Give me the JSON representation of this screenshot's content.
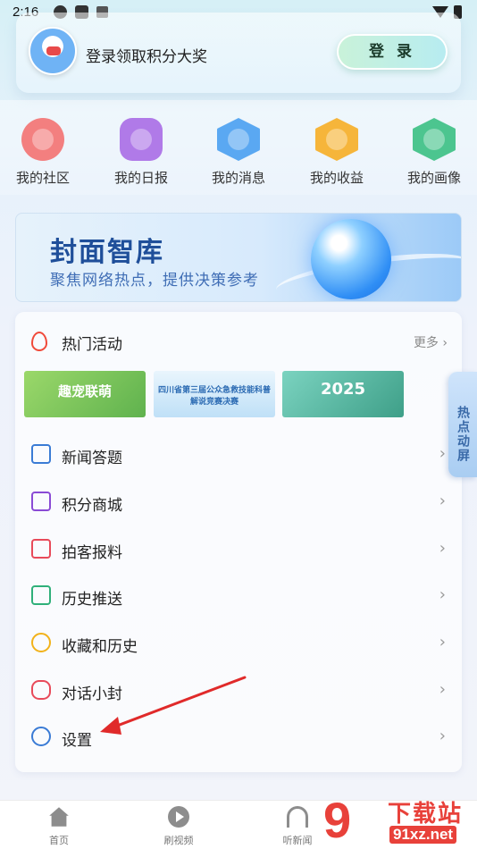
{
  "status_bar": {
    "time": "2:16"
  },
  "login": {
    "prompt": "登录领取积分大奖",
    "button_label": "登 录"
  },
  "quick_items": [
    {
      "label": "我的社区",
      "icon": "planet-icon",
      "color": "#f37f7f"
    },
    {
      "label": "我的日报",
      "icon": "calendar-icon",
      "color": "#b07ae8"
    },
    {
      "label": "我的消息",
      "icon": "message-icon",
      "color": "#5aa8f2"
    },
    {
      "label": "我的收益",
      "icon": "wallet-icon",
      "color": "#f6b53a"
    },
    {
      "label": "我的画像",
      "icon": "profile-chart-icon",
      "color": "#4cc58f"
    }
  ],
  "banner": {
    "title": "封面智库",
    "subtitle": "聚焦网络热点，提供决策参考"
  },
  "hot": {
    "label": "热门活动",
    "more": "更多 ›"
  },
  "thumbnails": [
    {
      "text": "趣宠联萌",
      "bg": "#7cc36a"
    },
    {
      "text": "四川省第三届公众急救技能科普解说竞赛决赛",
      "bg": "#bfe0f7"
    },
    {
      "text": "2025",
      "bg": "#5bb3a0"
    }
  ],
  "menu": [
    {
      "label": "新闻答题",
      "icon": "quiz-icon",
      "color": "#3a7bd5"
    },
    {
      "label": "积分商城",
      "icon": "shopping-bag-icon",
      "color": "#8a4ad5"
    },
    {
      "label": "拍客报料",
      "icon": "camera-icon",
      "color": "#e84a5a"
    },
    {
      "label": "历史推送",
      "icon": "history-calendar-icon",
      "color": "#2fb07a"
    },
    {
      "label": "收藏和历史",
      "icon": "star-icon",
      "color": "#f2b21a"
    },
    {
      "label": "对话小封",
      "icon": "chat-bot-icon",
      "color": "#e84a5a"
    },
    {
      "label": "设置",
      "icon": "settings-hex-icon",
      "color": "#3a7bd5"
    }
  ],
  "side_tab": {
    "label": "热点动屏"
  },
  "bottom_nav": [
    {
      "label": "首页",
      "icon": "home-icon"
    },
    {
      "label": "刷视频",
      "icon": "video-play-icon"
    },
    {
      "label": "听新闻",
      "icon": "headphones-icon"
    }
  ],
  "watermark": {
    "mark": "9",
    "title": "下载站",
    "url": "91xz.net"
  }
}
